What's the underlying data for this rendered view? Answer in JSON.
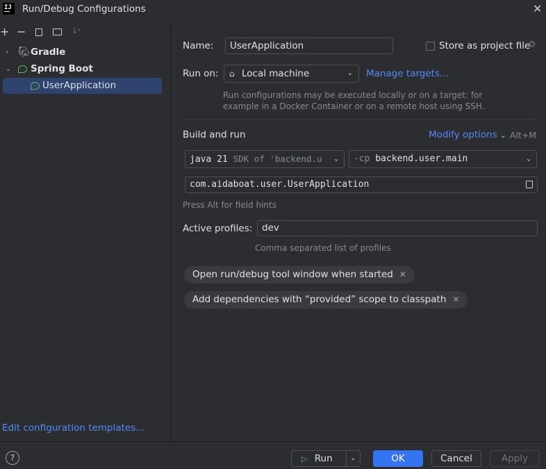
{
  "window": {
    "title": "Run/Debug Configurations",
    "app_icon_text": "IJ"
  },
  "sidebar": {
    "toolbar": [
      "add-icon",
      "remove-icon",
      "copy-icon",
      "new-folder-icon",
      "sort-icon"
    ],
    "tree": [
      {
        "label": "Gradle",
        "expanded": false,
        "level": 0
      },
      {
        "label": "Spring Boot",
        "expanded": true,
        "level": 0
      },
      {
        "label": "UserApplication",
        "selected": true,
        "level": 1
      }
    ],
    "edit_templates": "Edit configuration templates..."
  },
  "form": {
    "name_label": "Name:",
    "name_value": "UserApplication",
    "store_label": "Store as project file",
    "store_checked": false,
    "run_on_label": "Run on:",
    "run_on_value": "Local machine",
    "manage_targets": "Manage targets...",
    "run_on_hint_1": "Run configurations may be executed locally or on a target: for",
    "run_on_hint_2": "example in a Docker Container or on a remote host using SSH.",
    "build_run_title": "Build and run",
    "modify_options": "Modify options",
    "modify_shortcut": "Alt+M",
    "sdk_value": "java 21",
    "sdk_detail": "SDK of 'backend.u",
    "cp_prefix": "-cp",
    "cp_value": "backend.user.main",
    "main_class": "com.aidaboat.user.UserApplication",
    "field_hint": "Press Alt for field hints",
    "profiles_label": "Active profiles:",
    "profiles_value": "dev",
    "profiles_hint": "Comma separated list of profiles",
    "chips": [
      "Open run/debug tool window when started",
      "Add dependencies with “provided” scope to classpath"
    ]
  },
  "buttons": {
    "help": "?",
    "run": "Run",
    "ok": "OK",
    "cancel": "Cancel",
    "apply": "Apply"
  },
  "colors": {
    "accent": "#3574f0",
    "link": "#548af7",
    "spring": "#5fb865",
    "selection": "#2e436e"
  }
}
